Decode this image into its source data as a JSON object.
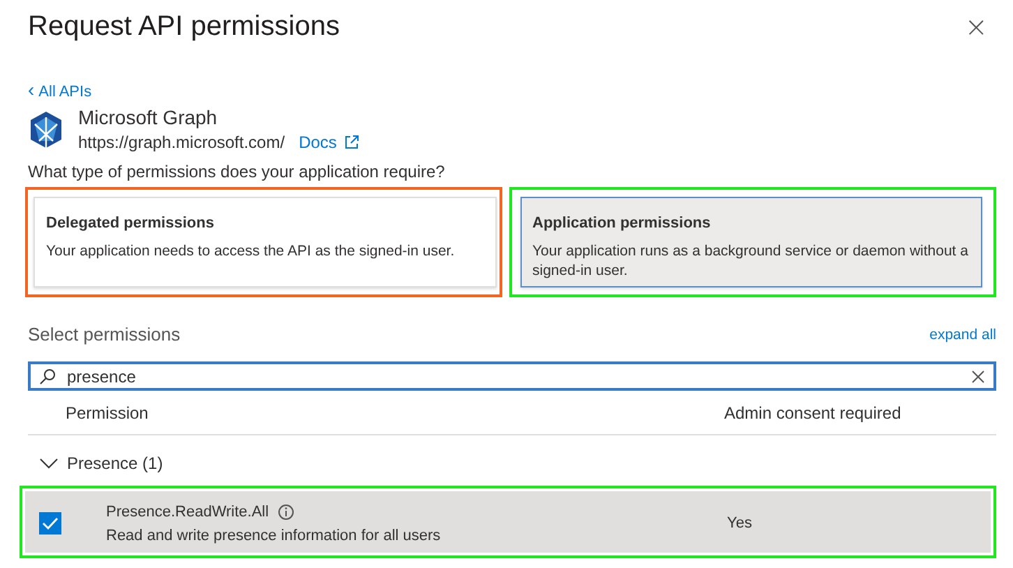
{
  "panel": {
    "title": "Request API permissions",
    "close": "×"
  },
  "back_link": {
    "icon": "‹",
    "label": "All APIs"
  },
  "api": {
    "name": "Microsoft Graph",
    "url": "https://graph.microsoft.com/",
    "docs": "Docs"
  },
  "question": "What type of permissions does your application require?",
  "permission_types": [
    {
      "title": "Delegated permissions",
      "description": "Your application needs to access the API as the signed-in user.",
      "selected": false,
      "color": "#f26522"
    },
    {
      "title": "Application permissions",
      "description": "Your application runs as a background service or daemon without a signed-in user.",
      "selected": true,
      "color": "#22e622"
    }
  ],
  "select_heading": "Select permissions",
  "expand_all": "expand all",
  "search": {
    "value": "presence"
  },
  "table": {
    "columns": [
      "Permission",
      "Admin consent required"
    ],
    "groups": [
      {
        "label": "Presence (1)",
        "expanded": true,
        "rows": [
          {
            "name": "Presence.ReadWrite.All",
            "description": "Read and write presence information for all users",
            "admin_consent": "Yes",
            "checked": true,
            "color": "#22e622"
          }
        ]
      }
    ]
  }
}
